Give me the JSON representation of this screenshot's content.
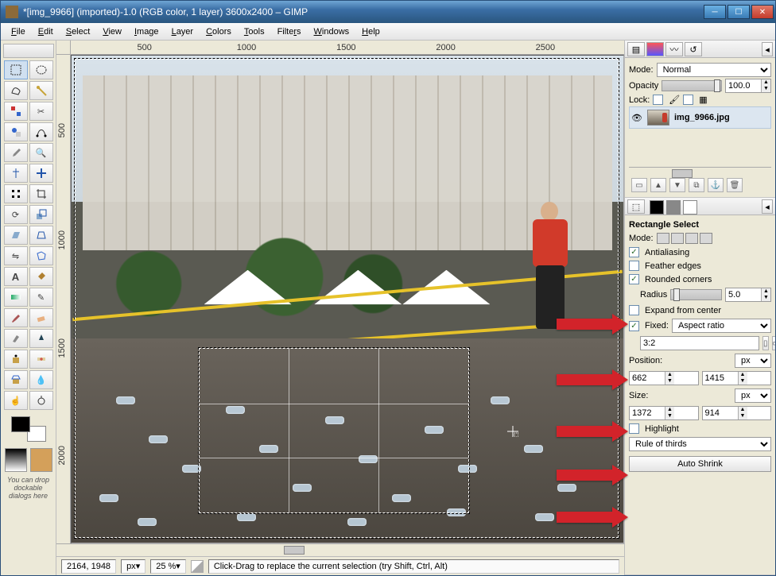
{
  "window": {
    "title": "*[img_9966] (imported)-1.0 (RGB color, 1 layer) 3600x2400 – GIMP"
  },
  "menu": {
    "file": "File",
    "edit": "Edit",
    "select": "Select",
    "view": "View",
    "image": "Image",
    "layer": "Layer",
    "colors": "Colors",
    "tools": "Tools",
    "filters": "Filters",
    "windows": "Windows",
    "help": "Help"
  },
  "ruler_h": [
    "500",
    "1000",
    "1500",
    "2000",
    "2500"
  ],
  "ruler_v": [
    "500",
    "1000",
    "1500",
    "2000"
  ],
  "toolbox_hint": "You can drop dockable dialogs here",
  "status": {
    "coords": "2164, 1948",
    "unit": "px",
    "zoom": "25 %",
    "hint": "Click-Drag to replace the current selection (try Shift, Ctrl, Alt)"
  },
  "layers_panel": {
    "mode_label": "Mode:",
    "mode_value": "Normal",
    "opacity_label": "Opacity",
    "opacity_value": "100.0",
    "lock_label": "Lock:",
    "layer_name": "img_9966.jpg"
  },
  "tool_options": {
    "title": "Rectangle Select",
    "mode_label": "Mode:",
    "antialias": "Antialiasing",
    "feather": "Feather edges",
    "rounded": "Rounded corners",
    "radius_label": "Radius",
    "radius_value": "5.0",
    "expand": "Expand from center",
    "fixed_label": "Fixed:",
    "fixed_value": "Aspect ratio",
    "ratio_value": "3:2",
    "position_label": "Position:",
    "pos_unit": "px",
    "pos_x": "662",
    "pos_y": "1415",
    "size_label": "Size:",
    "size_unit": "px",
    "size_w": "1372",
    "size_h": "914",
    "highlight": "Highlight",
    "guides_value": "Rule of thirds",
    "auto_shrink": "Auto Shrink"
  }
}
